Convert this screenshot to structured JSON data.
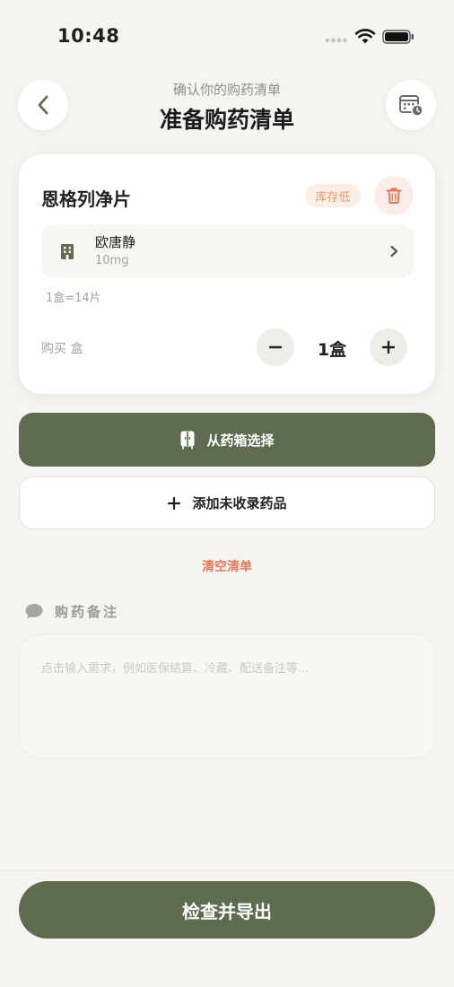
{
  "status_bar": {
    "time": "10:48"
  },
  "header": {
    "subtitle": "确认你的购药清单",
    "title": "准备购药清单",
    "back_icon": "chevron-left-icon",
    "calendar_icon": "calendar-clock-icon"
  },
  "medicine": {
    "name": "恩格列净片",
    "stock_badge": "库存低",
    "brand": {
      "name": "欧唐静",
      "dose": "10mg"
    },
    "pack_info": "1盒=14片",
    "buy_label": "购买 盒",
    "quantity": "1盒"
  },
  "actions": {
    "choose_from_cabinet": "从药箱选择",
    "add_unlisted": "添加未收录药品",
    "clear_list": "清空清单"
  },
  "notes": {
    "label": "购药备注",
    "placeholder": "点击输入需求，例如医保结算、冷藏、配送备注等...",
    "value": ""
  },
  "footer": {
    "export_label": "检查并导出"
  },
  "colors": {
    "background": "#f5f4f1",
    "primary": "#5e6b4f",
    "danger": "#e07a5f",
    "badge_text": "#e59a6e"
  }
}
